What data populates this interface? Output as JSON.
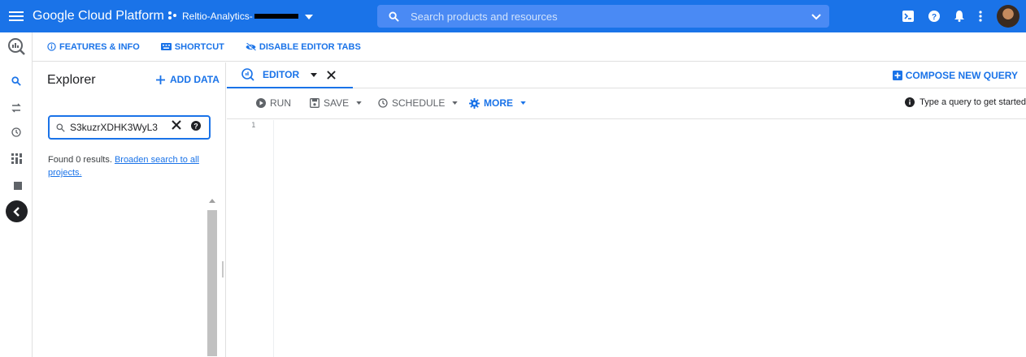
{
  "topbar": {
    "brand": "Google Cloud Platform",
    "project_label": "Reltio-Analytics-",
    "search_placeholder": "Search products and resources"
  },
  "subbar": {
    "features": "FEATURES & INFO",
    "shortcut": "SHORTCUT",
    "disable_tabs": "DISABLE EDITOR TABS"
  },
  "explorer": {
    "title": "Explorer",
    "add_data": "ADD DATA",
    "search_value": "S3kuzrXDHK3WyL3",
    "results_text": "Found 0 results.",
    "results_link": "Broaden search to all projects."
  },
  "editor": {
    "tab_label": "EDITOR",
    "compose": "COMPOSE NEW QUERY",
    "run": "RUN",
    "save": "SAVE",
    "schedule": "SCHEDULE",
    "more": "MORE",
    "hint": "Type a query to get started",
    "line_number": "1"
  },
  "colors": {
    "accent": "#1a73e8",
    "topbar": "#1a73e8"
  }
}
